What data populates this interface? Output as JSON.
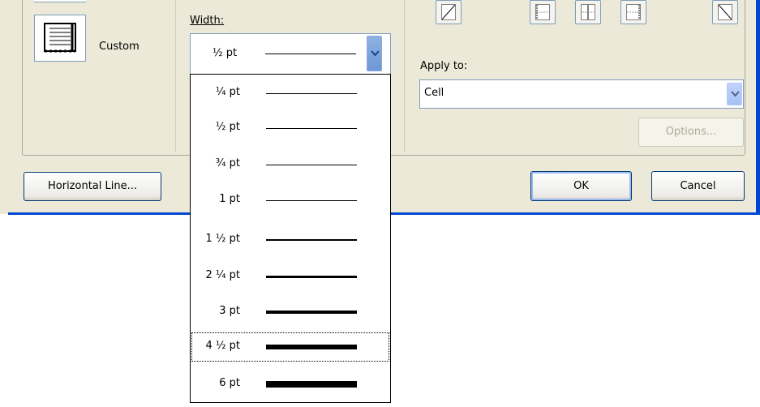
{
  "dialog": {
    "setting": {
      "custom_label": "Custom"
    },
    "width": {
      "label": "Width:",
      "selected": "½ pt",
      "options": [
        {
          "label": "¼ pt",
          "weight": 0.25
        },
        {
          "label": "½ pt",
          "weight": 0.5
        },
        {
          "label": "¾ pt",
          "weight": 0.75
        },
        {
          "label": "1 pt",
          "weight": 1
        },
        {
          "label": "1 ½ pt",
          "weight": 1.5
        },
        {
          "label": "2 ¼ pt",
          "weight": 2.25
        },
        {
          "label": "3 pt",
          "weight": 3
        },
        {
          "label": "4 ½ pt",
          "weight": 4.5
        },
        {
          "label": "6 pt",
          "weight": 6
        }
      ],
      "highlighted": "4 ½ pt"
    },
    "apply_to": {
      "label": "Apply to:",
      "value": "Cell"
    },
    "buttons": {
      "options": "Options...",
      "horizontal_line": "Horizontal Line...",
      "ok": "OK",
      "cancel": "Cancel"
    },
    "colors": {
      "dialog_bg": "#ece9d8",
      "title_blue": "#0046d5",
      "field_border": "#7f9db9"
    }
  }
}
